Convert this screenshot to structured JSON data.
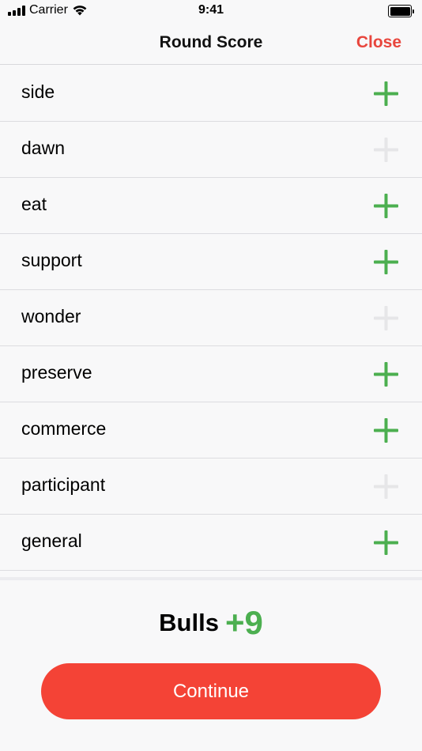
{
  "status_bar": {
    "carrier": "Carrier",
    "time": "9:41"
  },
  "header": {
    "title": "Round Score",
    "close_label": "Close"
  },
  "colors": {
    "accent_red": "#f44336",
    "close_red": "#e8463d",
    "active_green": "#4caf50",
    "inactive_gray": "#e6e6e8"
  },
  "words": [
    {
      "label": "side",
      "active": true
    },
    {
      "label": "dawn",
      "active": false
    },
    {
      "label": "eat",
      "active": true
    },
    {
      "label": "support",
      "active": true
    },
    {
      "label": "wonder",
      "active": false
    },
    {
      "label": "preserve",
      "active": true
    },
    {
      "label": "commerce",
      "active": true
    },
    {
      "label": "participant",
      "active": false
    },
    {
      "label": "general",
      "active": true
    }
  ],
  "score": {
    "label": "Bulls",
    "value": "+9"
  },
  "actions": {
    "continue_label": "Continue"
  }
}
